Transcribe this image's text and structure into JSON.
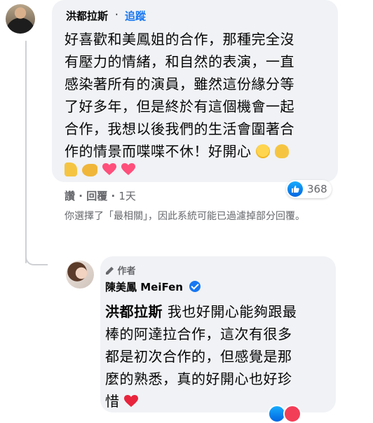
{
  "comment": {
    "author": "洪都拉斯",
    "separator": "·",
    "follow_label": "追蹤",
    "lines": [
      "好喜歡和美鳳姐的合作，那種完全沒",
      "有壓力的情緒，和自然的表演，一直",
      "感染著所有的演員，雖然這份緣分等",
      "了好多年，但是終於有這個機會一起",
      "合作，我想以後我們的生活會圍著合",
      "作的情景而喋喋不休！好開心"
    ],
    "emoji_icons": [
      "grinning-face-icon",
      "ok-hand-icon",
      "thumbs-up-icon",
      "flexed-biceps-icon",
      "sparkling-heart-icon",
      "sparkling-heart-icon"
    ],
    "like_label": "讚",
    "reply_label": "回覆",
    "time": "1天",
    "reaction_count": "368",
    "reaction_icon": "like-icon",
    "colors": {
      "link": "#1877f2",
      "bubble": "#f0f2f5",
      "muted": "#65676b"
    }
  },
  "filter_notice": "你選擇了「最相關」，因此系統可能已過濾掉部分回覆。",
  "reply": {
    "author_tag": "作者",
    "author_tag_icon": "pencil-icon",
    "author": "陳美鳳 MeiFen",
    "verified_icon": "verified-badge-icon",
    "mention": "洪都拉斯",
    "first_line_rest": " 我也好開心能夠跟最",
    "lines": [
      "棒的阿達拉合作，這次有很多",
      "都是初次合作的，但感覺是那",
      "麼的熟悉，真的好開心也好珍",
      "惜"
    ],
    "end_emoji": "red-heart-icon"
  }
}
